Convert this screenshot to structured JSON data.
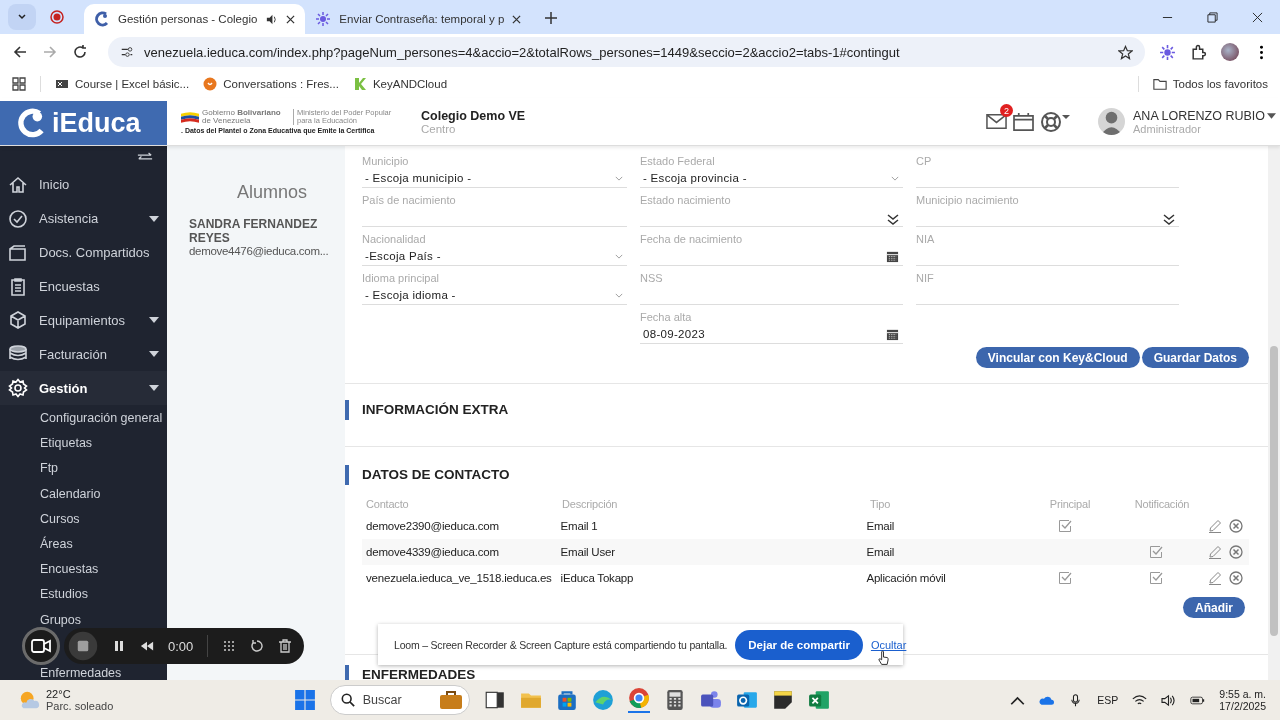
{
  "browser": {
    "tabs": [
      {
        "title": "Gestión personas - Colegio",
        "selected": true,
        "audio": true
      },
      {
        "title": "Enviar Contraseña: temporal y p",
        "selected": false,
        "audio": false
      }
    ],
    "url": "venezuela.ieduca.com/index.php?pageNum_persones=4&accio=2&totalRows_persones=1449&seccio=2&accio2=tabs-1#contingut",
    "bookmarks": [
      {
        "label": "Course | Excel básic..."
      },
      {
        "label": "Conversations : Fres..."
      },
      {
        "label": "KeyANDCloud"
      }
    ],
    "all_bookmarks": "Todos los favoritos"
  },
  "header": {
    "logo": "iEduca",
    "gov_name": "Gobierno **Bolivariano** de Venezuela",
    "ministry": "Ministerio del Poder Popular para la Educación",
    "gov_caption": ". Datos del Plantel o Zona Educativa que Emite la Certifica",
    "school": "Colegio Demo VE",
    "school_role": "Centro",
    "mail_badge": "2",
    "user": "ANA LORENZO RUBIO",
    "user_role": "Administrador"
  },
  "sidebar": {
    "items": [
      {
        "label": "Inicio",
        "submenu": false,
        "selected": false
      },
      {
        "label": "Asistencia",
        "submenu": true,
        "selected": false
      },
      {
        "label": "Docs. Compartidos",
        "submenu": false,
        "selected": false
      },
      {
        "label": "Encuestas",
        "submenu": false,
        "selected": false
      },
      {
        "label": "Equipamientos",
        "submenu": true,
        "selected": false
      },
      {
        "label": "Facturación",
        "submenu": true,
        "selected": false
      },
      {
        "label": "Gestión",
        "submenu": true,
        "selected": true,
        "children": [
          {
            "label": "Configuración general"
          },
          {
            "label": "Etiquetas"
          },
          {
            "label": "Ftp"
          },
          {
            "label": "Calendario"
          },
          {
            "label": "Cursos"
          },
          {
            "label": "Áreas"
          },
          {
            "label": "Encuestas"
          },
          {
            "label": "Estudios"
          },
          {
            "label": "Grupos"
          },
          {
            "label": "Enfermedades"
          }
        ]
      }
    ]
  },
  "person_panel": {
    "title": "Alumnos",
    "name": "SANDRA FERNANDEZ REYES",
    "email": "demove4476@ieduca.com..."
  },
  "form": {
    "rows": [
      [
        {
          "label": "Municipio",
          "kind": "select",
          "value": "- Escoja municipio -"
        },
        {
          "label": "Estado Federal",
          "kind": "select",
          "value": "- Escoja provincia -"
        },
        {
          "label": "CP",
          "kind": "text"
        }
      ],
      [
        {
          "label": "País de nacimiento",
          "kind": "text"
        },
        {
          "label": "Estado nacimiento",
          "kind": "combo"
        },
        {
          "label": "Municipio nacimiento",
          "kind": "combo"
        }
      ],
      [
        {
          "label": "Nacionalidad",
          "kind": "select",
          "value": "-Escoja País -"
        },
        {
          "label": "Fecha de nacimiento",
          "kind": "date"
        },
        {
          "label": "NIA",
          "kind": "text"
        }
      ],
      [
        {
          "label": "Idioma principal",
          "kind": "select",
          "value": "- Escoja idioma -"
        },
        {
          "label": "NSS",
          "kind": "text"
        },
        {
          "label": "NIF",
          "kind": "text"
        }
      ],
      [
        null,
        {
          "label": "Fecha alta",
          "kind": "date",
          "value": "08-09-2023"
        },
        null
      ]
    ],
    "buttons": [
      "Vincular con Key&Cloud",
      "Guardar Datos"
    ]
  },
  "sections": [
    {
      "title": "INFORMACIÓN EXTRA"
    },
    {
      "title": "DATOS DE CONTACTO"
    }
  ],
  "contacts": {
    "columns": [
      "Contacto",
      "Descripción",
      "Tipo",
      "Principal",
      "Notificación"
    ],
    "rows": [
      {
        "contact": "demove2390@ieduca.com",
        "description": "Email 1",
        "type": "Email",
        "principal": true,
        "notification": false
      },
      {
        "contact": "demove4339@ieduca.com",
        "description": "Email User",
        "type": "Email",
        "principal": false,
        "notification": true
      },
      {
        "contact": "venezuela.ieduca_ve_1518.ieduca.es",
        "description": "iEduca Tokapp",
        "type": "Aplicación móvil",
        "principal": true,
        "notification": true
      }
    ],
    "add_button": "Añadir"
  },
  "next_section": "ENFERMEDADES",
  "recorder": {
    "time": "0:00"
  },
  "share_bar": {
    "message": "Loom – Screen Recorder & Screen Capture está compartiendo tu pantalla.",
    "stop": "Dejar de compartir",
    "hide": "Ocultar"
  },
  "taskbar": {
    "temperature": "22°C",
    "weather": "Parc. soleado",
    "search": "Buscar",
    "language": "ESP",
    "time": "9:55 a. m.",
    "date": "17/2/2025"
  }
}
